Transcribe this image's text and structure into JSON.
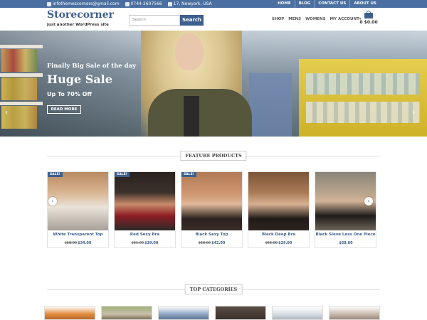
{
  "topbar": {
    "email": "infothemescorners@gmail.com",
    "phone": "0744-2607566",
    "address": "17, Newyork, USA",
    "links": [
      "HOME",
      "BLOG",
      "CONTACT US",
      "ABOUT US"
    ]
  },
  "header": {
    "site_title": "Storecorner",
    "tagline": "Just another WordPress site",
    "search_placeholder": "Search",
    "search_button": "Search",
    "nav": [
      "SHOP",
      "MENS",
      "WOMENS",
      "MY ACCOUNT"
    ],
    "cart_total": "0 $0.00"
  },
  "hero": {
    "subtitle": "Finally Big Sale of the day",
    "title": "Huge Sale",
    "discount": "Up To 70% Off",
    "button": "READ MORE"
  },
  "featured": {
    "heading": "FEATURE PRODUCTS",
    "sale_badge": "SALE!",
    "products": [
      {
        "name": "White Transparent Top",
        "old_price": "$58.00",
        "new_price": "$34.00",
        "colors": [
          "#b88a62",
          "#e9e3d8"
        ]
      },
      {
        "name": "Red Sexy Bra",
        "old_price": "$51.00",
        "new_price": "$29.00",
        "colors": [
          "#2a2320",
          "#8d1c22"
        ]
      },
      {
        "name": "Black Sexy Top",
        "old_price": "$58.00",
        "new_price": "$42.00",
        "colors": [
          "#b17a56",
          "#2b2220"
        ]
      },
      {
        "name": "Black Deep Bra",
        "old_price": "$55.00",
        "new_price": "$29.00",
        "colors": [
          "#7d5438",
          "#1f1a18"
        ]
      },
      {
        "name": "Black Sleve Less One Piece",
        "old_price": "",
        "new_price": "$58.00",
        "colors": [
          "#8a8478",
          "#1d1b1a"
        ]
      }
    ]
  },
  "categories": {
    "heading": "TOP CATEGORIES",
    "thumbs": [
      "#e28b3d",
      "#9fb07c",
      "#8fa6c4",
      "#5a4e45",
      "#d8dde4",
      "#c9b9ad"
    ]
  },
  "colors": {
    "accent": "#3d5f8d",
    "topbar": "#4a6fa0"
  }
}
